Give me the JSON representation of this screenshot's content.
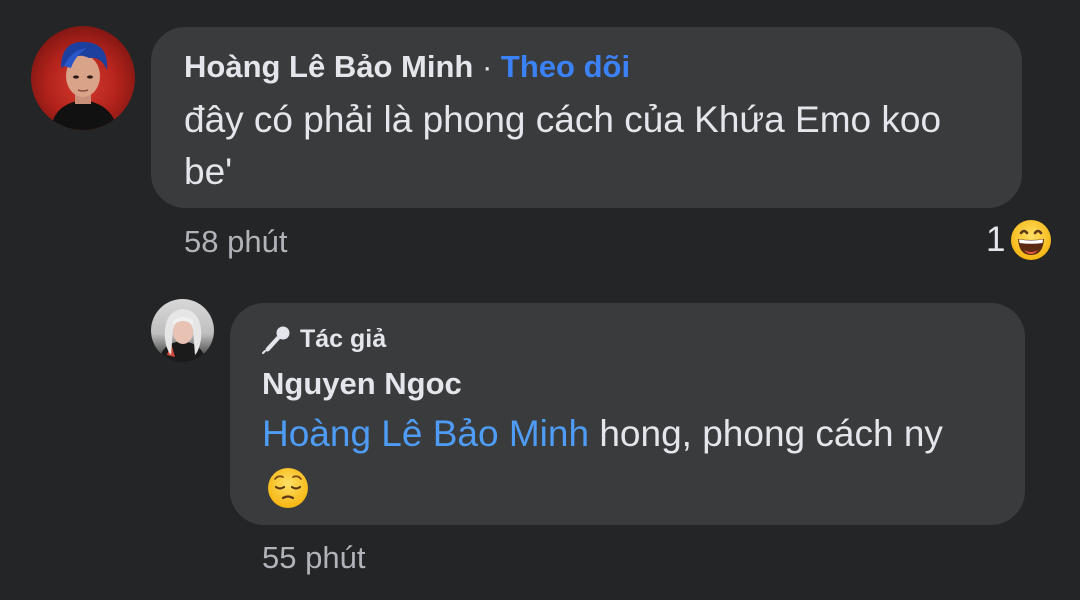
{
  "comment": {
    "author": "Hoàng Lê Bảo Minh",
    "separator": "·",
    "follow_label": "Theo dõi",
    "text": "đây có phải là phong cách của Khứa Emo koo\nbeʹ",
    "time": "58 phút",
    "reaction_count": "1",
    "reaction_icon": "grinning-face-emoji",
    "colors": {
      "follow": "#3b82f6",
      "bubble": "#3a3b3c",
      "background": "#242526"
    }
  },
  "reply": {
    "badge_icon": "microphone-icon",
    "badge_label": "Tác giả",
    "author": "Nguyen Ngoc",
    "mention": "Hoàng Lê Bảo Minh",
    "text": " hong, phong cách ny",
    "emoji": "pensive-face-emoji",
    "time": "55 phút",
    "colors": {
      "mention": "#4e9cf5"
    }
  }
}
